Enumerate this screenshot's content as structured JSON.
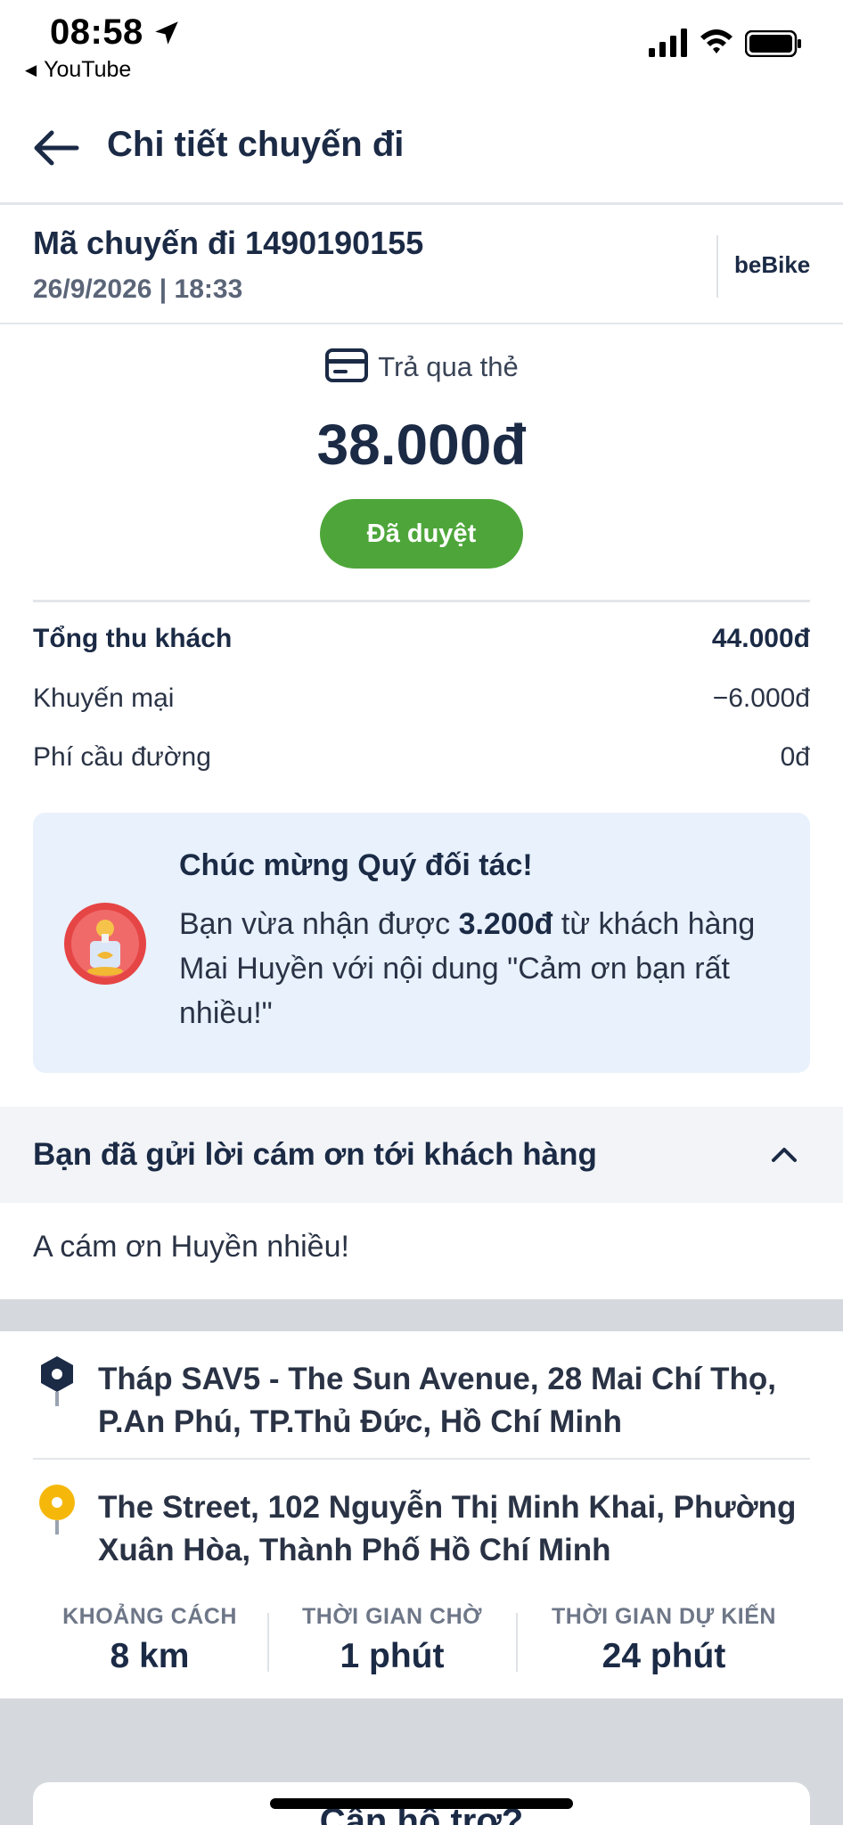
{
  "status_bar": {
    "time": "08:58",
    "back_app": "YouTube",
    "icons": [
      "location-arrow-icon",
      "signal-icon",
      "wifi-icon",
      "battery-icon"
    ]
  },
  "header": {
    "title": "Chi tiết chuyến đi",
    "back_icon": "arrow-left-icon"
  },
  "trip": {
    "code": "Mã chuyến đi 1490190155",
    "datetime": "26/9/2026 | 18:33",
    "service": "beBike"
  },
  "payment": {
    "method": "Trả qua thẻ",
    "amount": "38.000đ",
    "status": "Đã duyệt",
    "status_color": "#4ea63a"
  },
  "fees": [
    {
      "label": "Tổng thu khách",
      "value": "44.000đ"
    },
    {
      "label": "Khuyến mại",
      "value": "−6.000đ"
    },
    {
      "label": "Phí cầu đường",
      "value": "0đ"
    }
  ],
  "congrats": {
    "title": "Chúc mừng Quý đối tác!",
    "text_before": "Bạn vừa nhận được ",
    "tip_amount": "3.200đ",
    "text_after": " từ khách hàng Mai Huyền với nội dung \"Cảm ơn bạn rất nhiều!\""
  },
  "thanks": {
    "title": "Bạn đã gửi lời cám ơn tới khách hàng",
    "message": "A cám ơn Huyền nhiều!"
  },
  "route": {
    "pickup": "Tháp SAV5 - The Sun Avenue, 28 Mai Chí Thọ, P.An Phú, TP.Thủ Đức, Hồ Chí Minh",
    "dropoff": "The Street, 102 Nguyễn Thị Minh Khai, Phường Xuân Hòa, Thành Phố Hồ Chí Minh"
  },
  "stats": [
    {
      "label": "KHOẢNG CÁCH",
      "value": "8 km"
    },
    {
      "label": "THỜI GIAN CHỜ",
      "value": "1 phút"
    },
    {
      "label": "THỜI GIAN DỰ KIẾN",
      "value": "24 phút"
    }
  ],
  "support": {
    "title": "Cần hỗ trợ?"
  },
  "colors": {
    "primary_text": "#1b2a45",
    "approved_green": "#4ea63a",
    "card_bg": "#e8f1fc",
    "pickup_pin": "#1b2a45",
    "dropoff_pin": "#f5b80a"
  }
}
